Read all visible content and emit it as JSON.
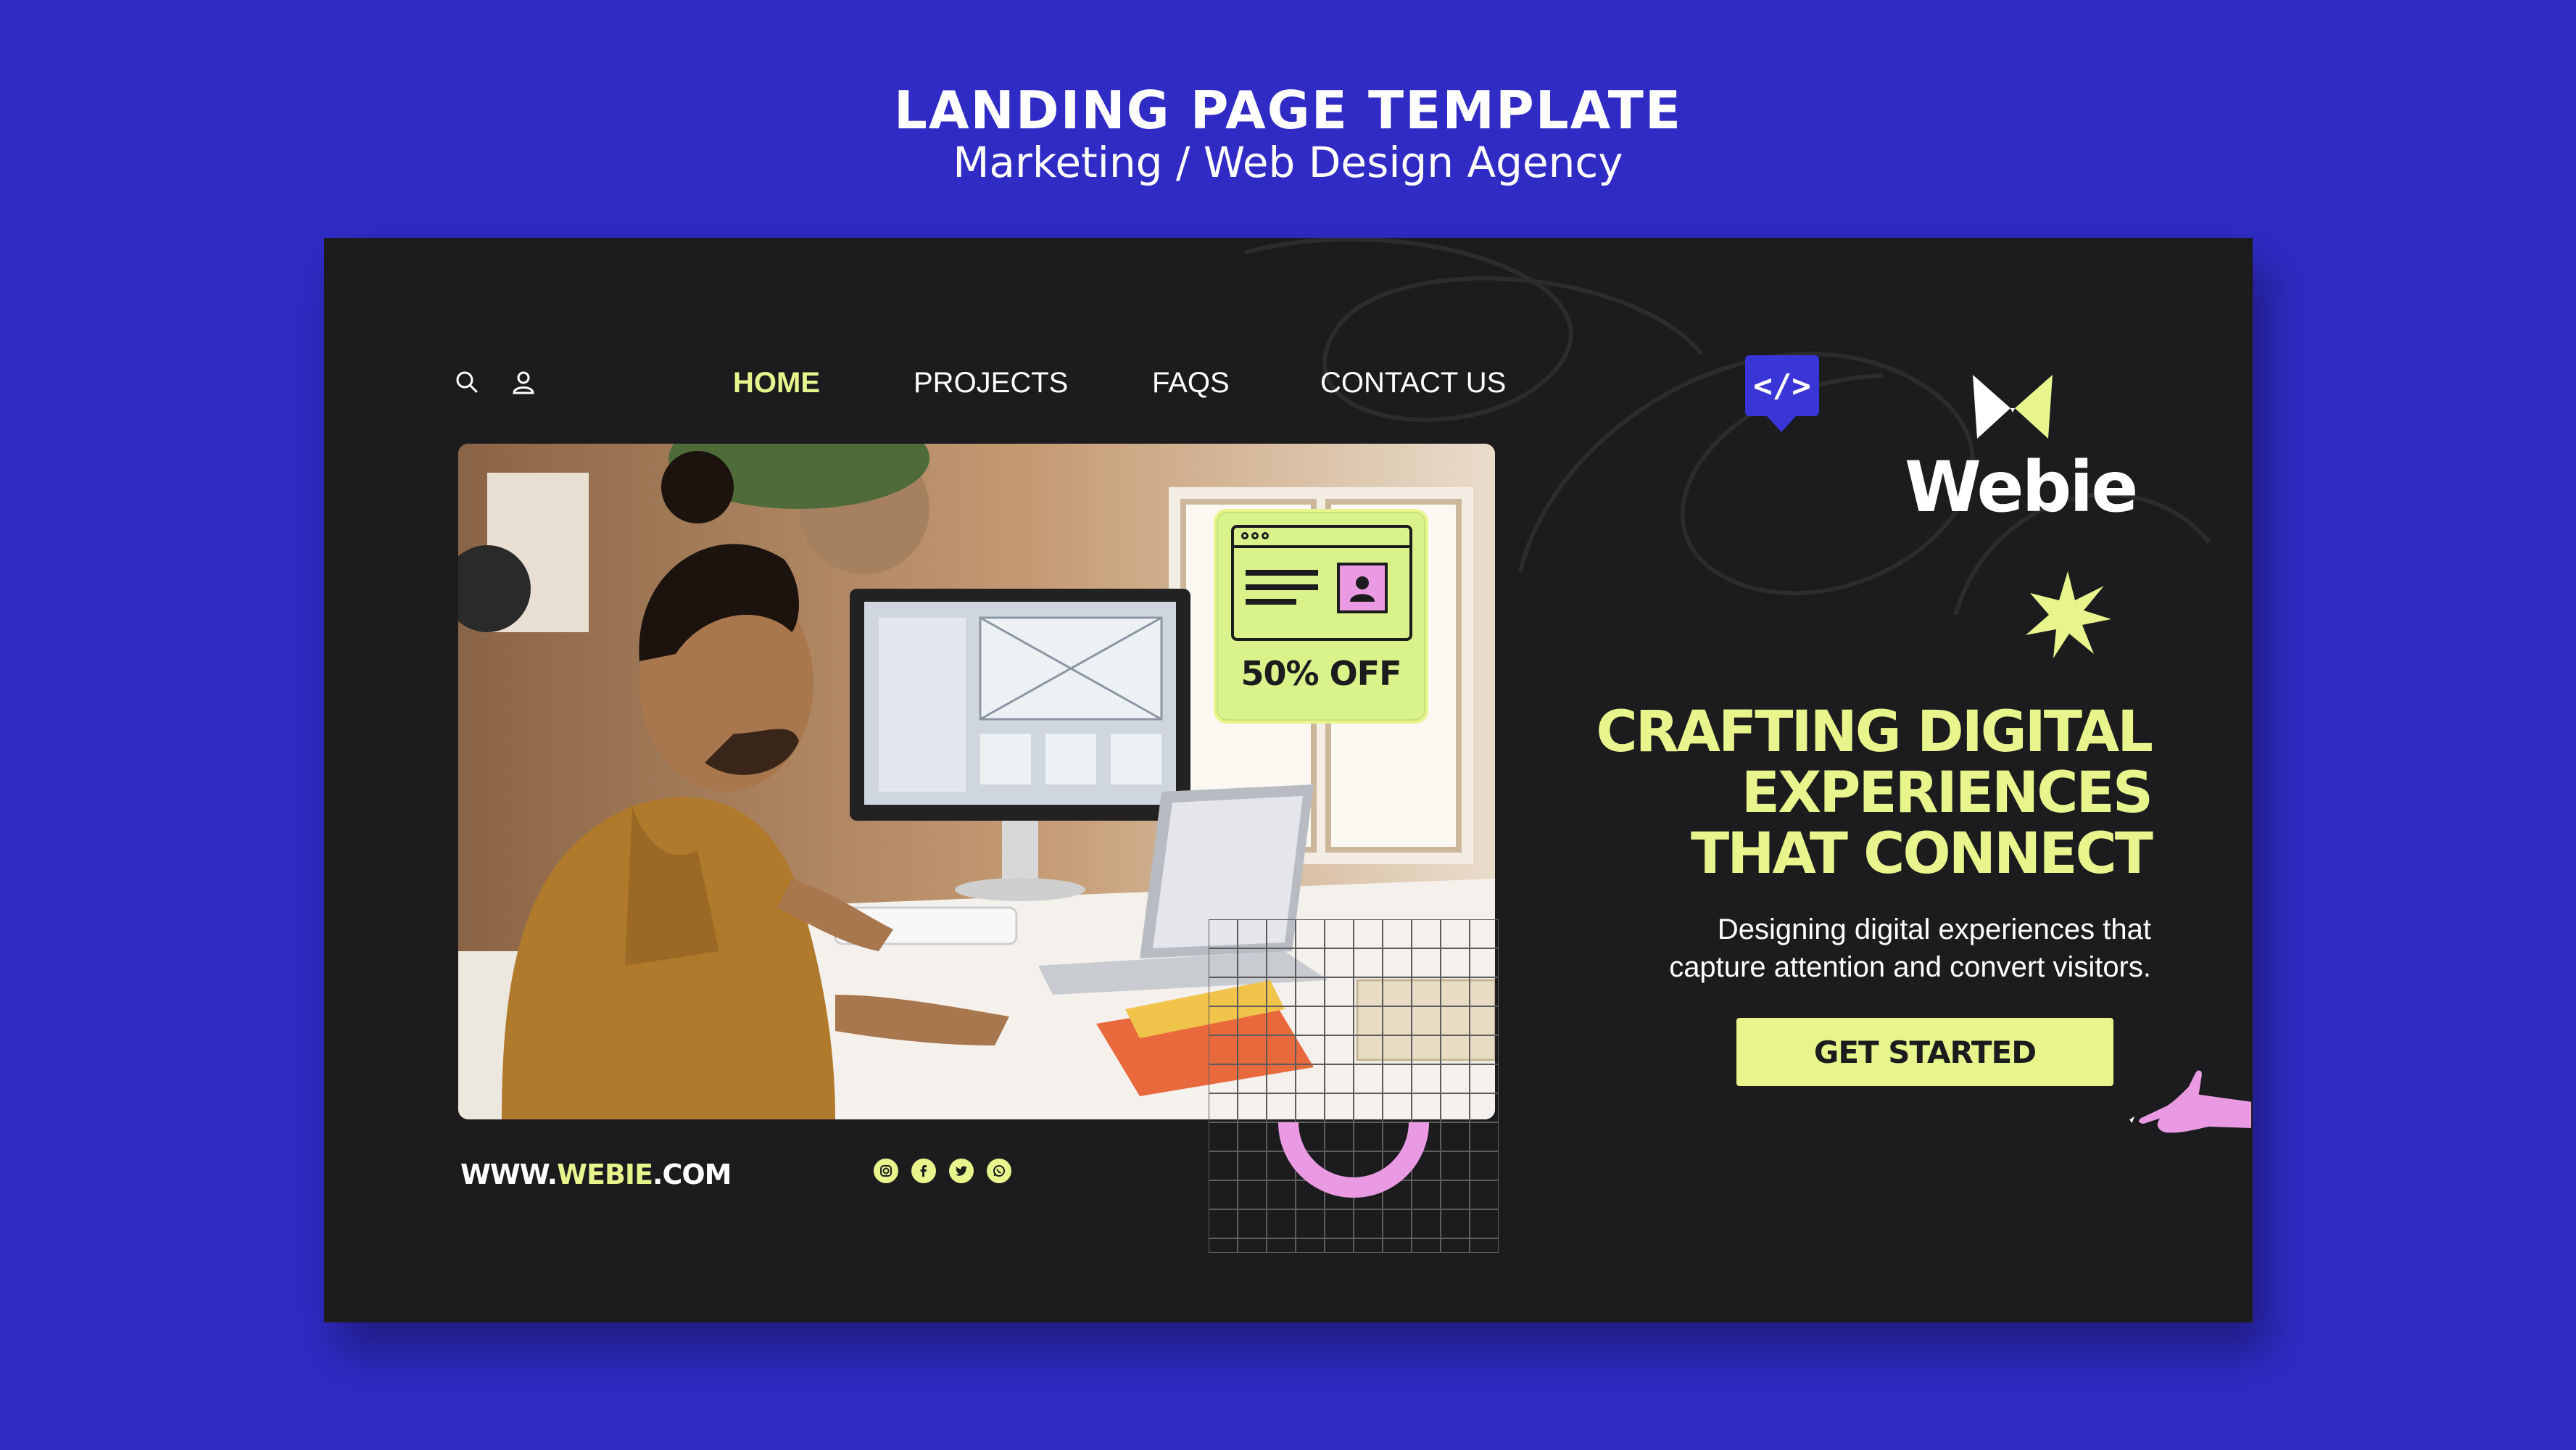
{
  "header": {
    "title": "LANDING PAGE TEMPLATE",
    "subtitle": "Marketing / Web Design Agency"
  },
  "nav": {
    "items": [
      {
        "label": "HOME",
        "active": true
      },
      {
        "label": "PROJECTS",
        "active": false
      },
      {
        "label": "FAQS",
        "active": false
      },
      {
        "label": "CONTACT US",
        "active": false
      }
    ]
  },
  "icons": {
    "search": "search-icon",
    "user": "user-icon",
    "code": "code-icon",
    "logo": "butterfly-logo-icon",
    "star": "sparkle-star-icon",
    "hand": "hand-pointer-icon"
  },
  "code_badge": "</>",
  "brand": {
    "name": "Webie"
  },
  "promo": {
    "label": "50% OFF"
  },
  "hero": {
    "headline_line1": "CRAFTING DIGITAL",
    "headline_line2": "EXPERIENCES",
    "headline_line3": "THAT CONNECT",
    "subtext_line1": "Designing digital experiences that",
    "subtext_line2": "capture attention and convert visitors.",
    "cta_label": "GET STARTED"
  },
  "footer": {
    "url_prefix": "WWW.",
    "url_highlight": "WEBIE",
    "url_suffix": ".COM",
    "socials": [
      "instagram-icon",
      "facebook-icon",
      "twitter-icon",
      "whatsapp-icon"
    ]
  },
  "colors": {
    "background": "#2f2bc4",
    "page": "#1c1c1e",
    "accent": "#e8f58c",
    "pink": "#e99ae3",
    "badge": "#3a35d6"
  }
}
